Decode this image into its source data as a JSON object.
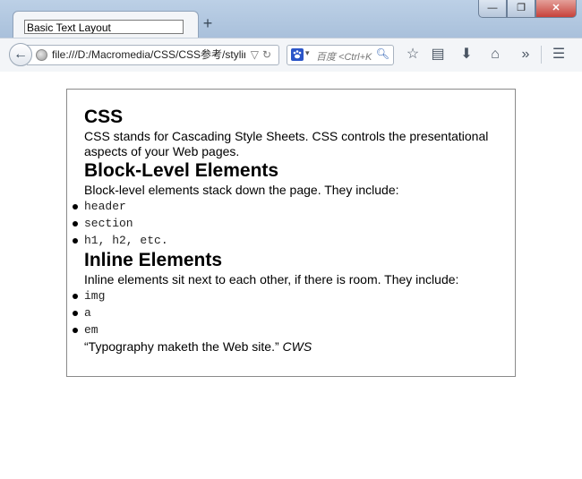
{
  "window": {
    "tab_title": "Basic Text Layout",
    "new_tab_label": "+",
    "minimize_label": "—",
    "maximize_label": "❐",
    "close_label": "✕"
  },
  "toolbar": {
    "url": "file:///D:/Macromedia/CSS/CSS参考/stylir",
    "search_placeholder": "百度 <Ctrl+K",
    "search_engine_label": "",
    "icons": [
      "back-icon",
      "globe-icon",
      "dropdown-icon",
      "reload-icon",
      "search-engine-icon",
      "search-icon",
      "star-icon",
      "reading-list-icon",
      "download-icon",
      "home-icon",
      "overflow-icon",
      "menu-icon"
    ]
  },
  "page": {
    "sections": [
      {
        "heading": "CSS",
        "paragraph": "CSS stands for Cascading Style Sheets. CSS controls the presentational aspects of your Web pages."
      },
      {
        "heading": "Block-Level Elements",
        "paragraph": "Block-level elements stack down the page. They include:",
        "items": [
          "header",
          "section",
          "h1, h2, etc."
        ]
      },
      {
        "heading": "Inline Elements",
        "paragraph": "Inline elements sit next to each other, if there is room. They include:",
        "items": [
          "img",
          "a",
          "em"
        ]
      }
    ],
    "quote": {
      "text": "“Typography maketh the Web site.”",
      "cite": "CWS"
    }
  }
}
